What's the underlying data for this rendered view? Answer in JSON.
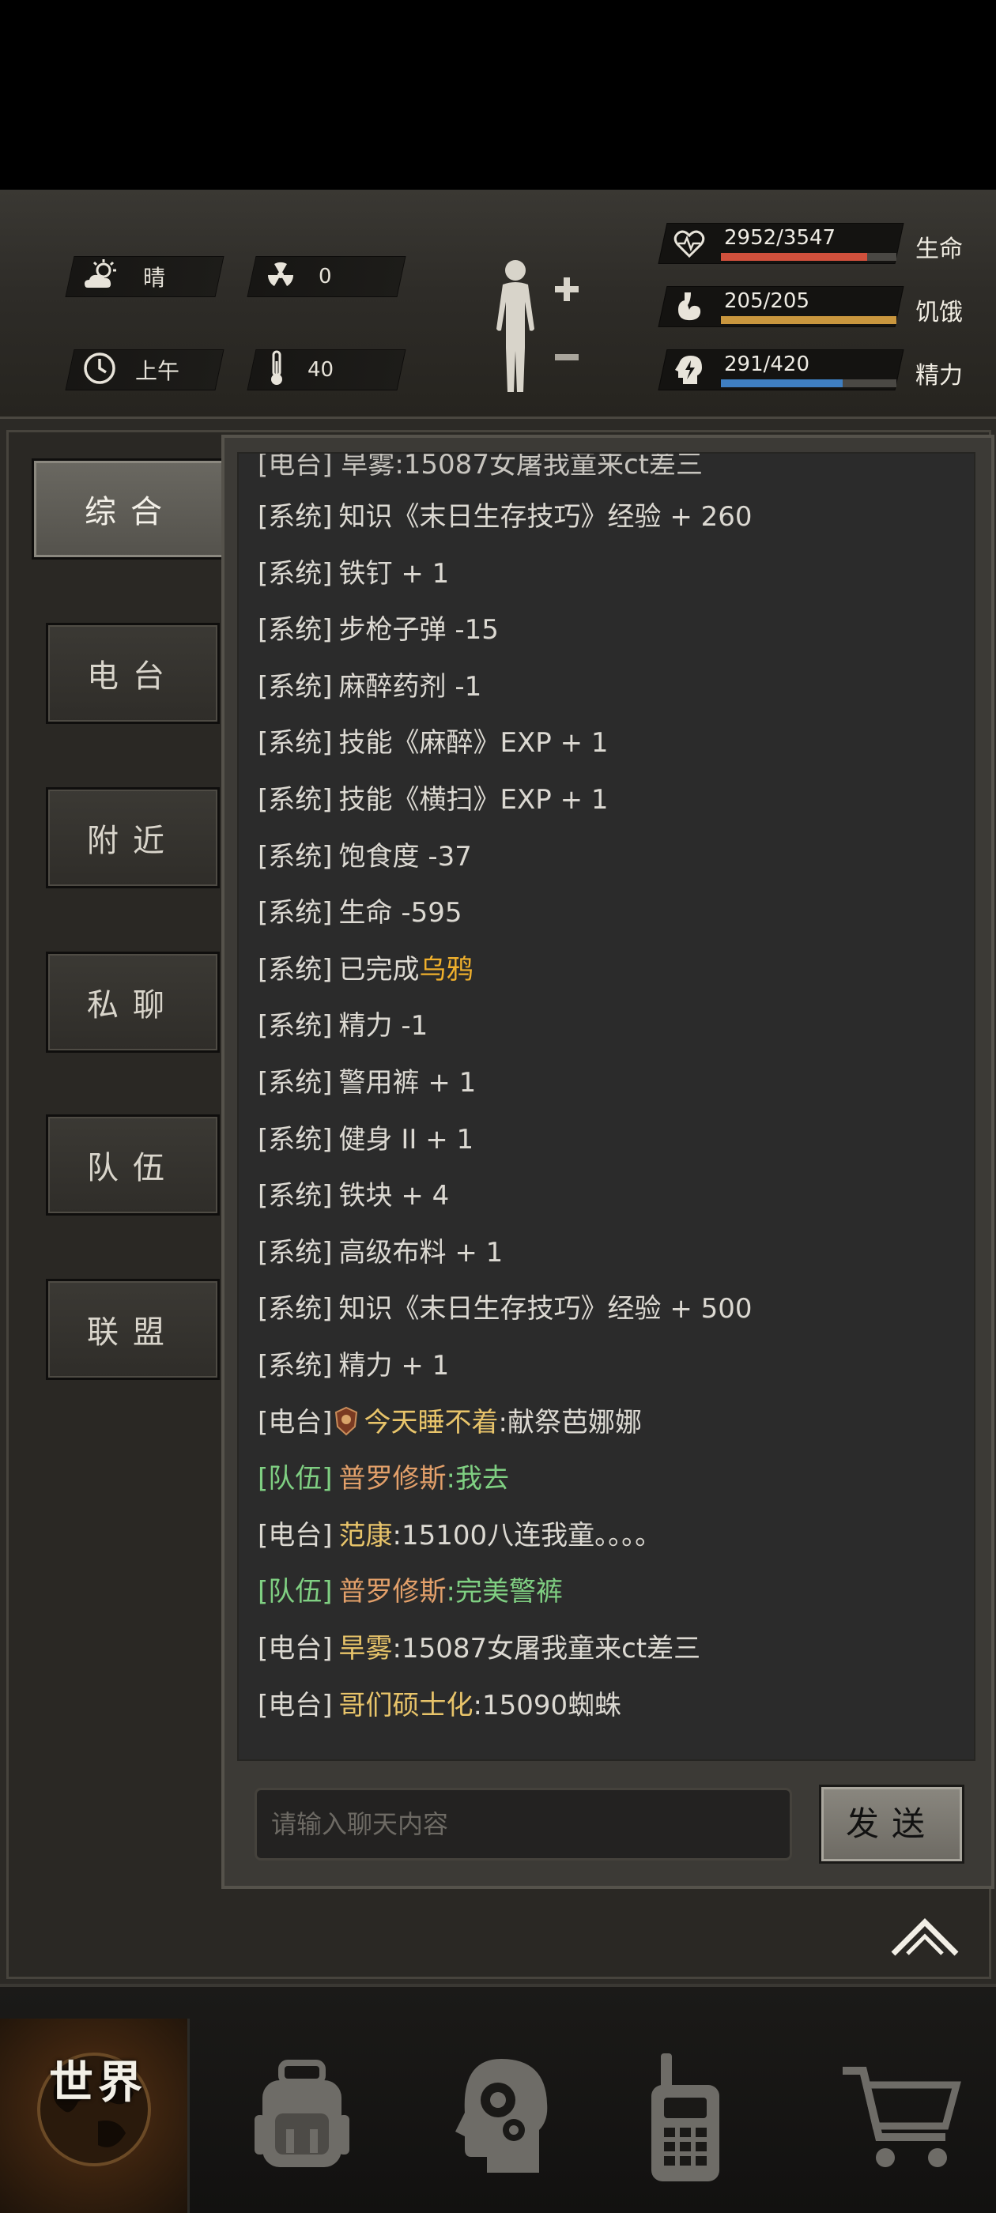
{
  "hud": {
    "weather": {
      "label": "晴",
      "icon": "cloud-sun-icon"
    },
    "radiation": {
      "value": "0",
      "icon": "radiation-icon"
    },
    "time_of_day": {
      "label": "上午",
      "icon": "clock-icon"
    },
    "temperature": {
      "value": "40",
      "icon": "thermometer-icon"
    },
    "body_status": {
      "icon": "body-figure-icon",
      "plus": "+",
      "minus": "−"
    },
    "stats": [
      {
        "name": "生命",
        "value": "2952/3547",
        "fraction": 0.832,
        "color": "#d0503c",
        "icon": "heart-pulse-icon"
      },
      {
        "name": "饥饿",
        "value": "205/205",
        "fraction": 1.0,
        "color": "#c9963e",
        "icon": "stomach-icon"
      },
      {
        "name": "精力",
        "value": "291/420",
        "fraction": 0.693,
        "color": "#3f7fc2",
        "icon": "head-lightning-icon"
      }
    ]
  },
  "tabs": [
    {
      "label": "综合",
      "active": true
    },
    {
      "label": "电台",
      "active": false
    },
    {
      "label": "附近",
      "active": false
    },
    {
      "label": "私聊",
      "active": false
    },
    {
      "label": "队伍",
      "active": false
    },
    {
      "label": "联盟",
      "active": false
    }
  ],
  "chat": {
    "partial_top": "[电台] 旱雾:15087女屠我童来ct差三",
    "messages": [
      {
        "channel": "[系统]",
        "type": "sys",
        "text": "知识《末日生存技巧》经验 + 260"
      },
      {
        "channel": "[系统]",
        "type": "sys",
        "text": "铁钉 + 1"
      },
      {
        "channel": "[系统]",
        "type": "sys",
        "text": "步枪子弹 -15"
      },
      {
        "channel": "[系统]",
        "type": "sys",
        "text": "麻醉药剂 -1"
      },
      {
        "channel": "[系统]",
        "type": "sys",
        "text": "技能《麻醉》EXP + 1"
      },
      {
        "channel": "[系统]",
        "type": "sys",
        "text": "技能《横扫》EXP + 1"
      },
      {
        "channel": "[系统]",
        "type": "sys",
        "text": "饱食度 -37"
      },
      {
        "channel": "[系统]",
        "type": "sys",
        "text": "生命 -595"
      },
      {
        "channel": "[系统]",
        "type": "sys-hl",
        "text": "已完成",
        "highlight": "乌鸦"
      },
      {
        "channel": "[系统]",
        "type": "sys",
        "text": "精力 -1"
      },
      {
        "channel": "[系统]",
        "type": "sys",
        "text": "警用裤 + 1"
      },
      {
        "channel": "[系统]",
        "type": "sys",
        "text": "健身 II + 1"
      },
      {
        "channel": "[系统]",
        "type": "sys",
        "text": "铁块 + 4"
      },
      {
        "channel": "[系统]",
        "type": "sys",
        "text": "高级布料 + 1"
      },
      {
        "channel": "[系统]",
        "type": "sys",
        "text": "知识《末日生存技巧》经验 + 500"
      },
      {
        "channel": "[系统]",
        "type": "sys",
        "text": "精力 + 1"
      },
      {
        "channel": "[电台]",
        "type": "radio-badge",
        "sender": "今天睡不着",
        "text": ":献祭芭娜娜"
      },
      {
        "channel": "[队伍]",
        "type": "team",
        "sender": "普罗修斯",
        "text": ":我去"
      },
      {
        "channel": "[电台]",
        "type": "radio",
        "sender": "范康",
        "text": ":15100八连我童。。。。"
      },
      {
        "channel": "[队伍]",
        "type": "team",
        "sender": "普罗修斯",
        "text": ":完美警裤"
      },
      {
        "channel": "[电台]",
        "type": "radio",
        "sender": "旱雾",
        "text": ":15087女屠我童来ct差三"
      },
      {
        "channel": "[电台]",
        "type": "radio",
        "sender": "哥们硕士化",
        "text": ":15090蜘蛛"
      }
    ],
    "input_placeholder": "请输入聊天内容",
    "send_label": "发送"
  },
  "nav": [
    {
      "label": "世界",
      "icon": "globe-icon",
      "active": true
    },
    {
      "label": "",
      "icon": "backpack-icon",
      "active": false
    },
    {
      "label": "",
      "icon": "head-gears-icon",
      "active": false
    },
    {
      "label": "",
      "icon": "walkie-talkie-icon",
      "active": false
    },
    {
      "label": "",
      "icon": "shopping-cart-icon",
      "active": false
    }
  ]
}
